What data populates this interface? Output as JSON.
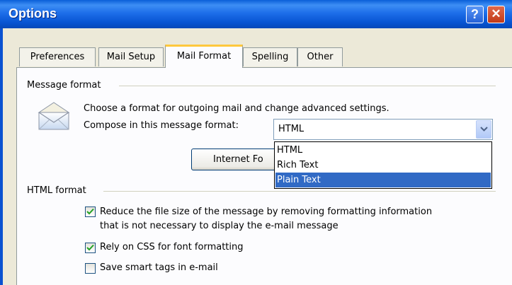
{
  "window": {
    "title": "Options"
  },
  "tabs": [
    {
      "label": "Preferences"
    },
    {
      "label": "Mail Setup"
    },
    {
      "label": "Mail Format"
    },
    {
      "label": "Spelling"
    },
    {
      "label": "Other"
    }
  ],
  "message_format": {
    "heading": "Message format",
    "description": "Choose a format for outgoing mail and change advanced settings.",
    "compose_label": "Compose in this message format:",
    "compose_value": "HTML",
    "options": [
      "HTML",
      "Rich Text",
      "Plain Text"
    ],
    "highlighted_option": "Plain Text",
    "internet_button": "Internet Fo"
  },
  "html_format": {
    "heading": "HTML format",
    "reduce_size_line1": "Reduce the file size of the message by removing formatting information",
    "reduce_size_line2": "that is not necessary to display the e-mail message",
    "reduce_size_checked": true,
    "rely_css": "Rely on CSS for font formatting",
    "rely_css_checked": true,
    "smart_tags": "Save smart tags in e-mail",
    "smart_tags_checked": false
  },
  "icons": {
    "envelope": "envelope-icon",
    "help": "help-icon",
    "close": "close-icon",
    "dropdown": "chevron-down-icon",
    "check": "check-icon"
  },
  "colors": {
    "titlebar": "#0A5FD8",
    "selection": "#316AC5",
    "tab_highlight": "#FFC83C"
  }
}
